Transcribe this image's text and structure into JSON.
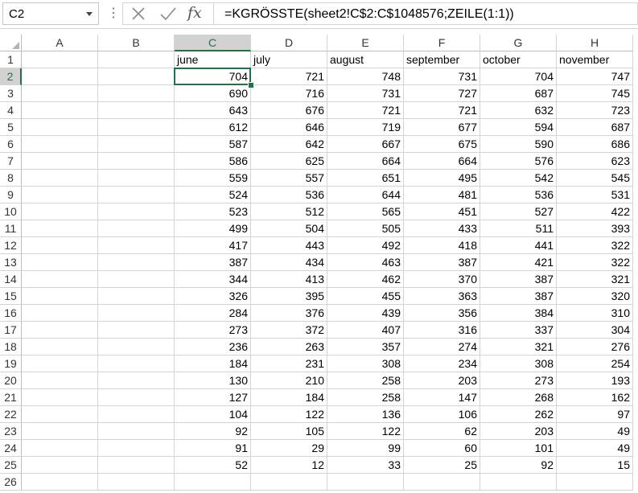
{
  "name_box": {
    "value": "C2"
  },
  "formula_bar": {
    "dots": "⋮",
    "cancel_icon": "x-icon",
    "enter_icon": "check-icon",
    "fx_label": "fx",
    "formula": "=KGRÖSSTE(sheet2!C$2:C$1048576;ZEILE(1:1))"
  },
  "sheet": {
    "selected_cell": "C2",
    "columns": [
      "A",
      "B",
      "C",
      "D",
      "E",
      "F",
      "G",
      "H"
    ],
    "row_numbers": [
      "1",
      "2",
      "3",
      "4",
      "5",
      "6",
      "7",
      "8",
      "9",
      "10",
      "11",
      "12",
      "13",
      "14",
      "15",
      "16",
      "17",
      "18",
      "19",
      "20",
      "21",
      "22",
      "23",
      "24",
      "25",
      "26"
    ],
    "header_row": [
      "",
      "",
      "june",
      "july",
      "august",
      "september",
      "october",
      "november"
    ],
    "data_rows": [
      [
        "704",
        "721",
        "748",
        "731",
        "704",
        "747"
      ],
      [
        "690",
        "716",
        "731",
        "727",
        "687",
        "745"
      ],
      [
        "643",
        "676",
        "721",
        "721",
        "632",
        "723"
      ],
      [
        "612",
        "646",
        "719",
        "677",
        "594",
        "687"
      ],
      [
        "587",
        "642",
        "667",
        "675",
        "590",
        "686"
      ],
      [
        "586",
        "625",
        "664",
        "664",
        "576",
        "623"
      ],
      [
        "559",
        "557",
        "651",
        "495",
        "542",
        "545"
      ],
      [
        "524",
        "536",
        "644",
        "481",
        "536",
        "531"
      ],
      [
        "523",
        "512",
        "565",
        "451",
        "527",
        "422"
      ],
      [
        "499",
        "504",
        "505",
        "433",
        "511",
        "393"
      ],
      [
        "417",
        "443",
        "492",
        "418",
        "441",
        "322"
      ],
      [
        "387",
        "434",
        "463",
        "387",
        "421",
        "322"
      ],
      [
        "344",
        "413",
        "462",
        "370",
        "387",
        "321"
      ],
      [
        "326",
        "395",
        "455",
        "363",
        "387",
        "320"
      ],
      [
        "284",
        "376",
        "439",
        "356",
        "384",
        "310"
      ],
      [
        "273",
        "372",
        "407",
        "316",
        "337",
        "304"
      ],
      [
        "236",
        "263",
        "357",
        "274",
        "321",
        "276"
      ],
      [
        "184",
        "231",
        "308",
        "234",
        "308",
        "254"
      ],
      [
        "130",
        "210",
        "258",
        "203",
        "273",
        "193"
      ],
      [
        "127",
        "184",
        "258",
        "147",
        "268",
        "162"
      ],
      [
        "104",
        "122",
        "136",
        "106",
        "262",
        "97"
      ],
      [
        "92",
        "105",
        "122",
        "62",
        "203",
        "49"
      ],
      [
        "91",
        "29",
        "99",
        "60",
        "101",
        "49"
      ],
      [
        "52",
        "12",
        "33",
        "25",
        "92",
        "15"
      ]
    ],
    "colors": {
      "accent": "#217346",
      "header_selected_bg": "#d2d2d2",
      "gridline": "#d4d4d4"
    }
  }
}
